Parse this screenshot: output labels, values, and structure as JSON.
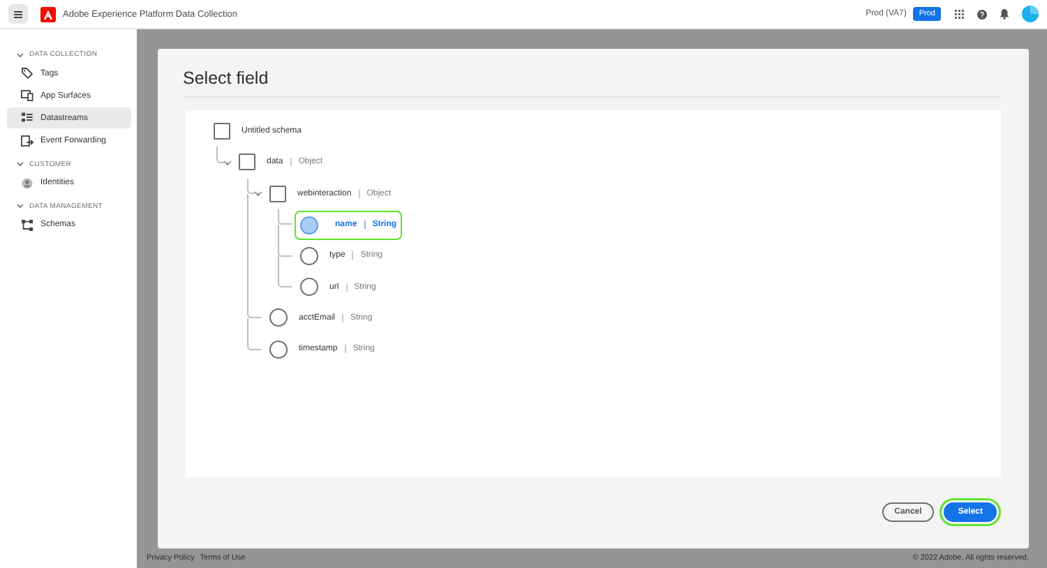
{
  "header": {
    "title": "Adobe Experience Platform Data Collection",
    "org": "Prod (VA7)",
    "sandbox_badge": "Prod"
  },
  "sidebar": {
    "sections": [
      {
        "heading": "DATA COLLECTION",
        "expanded": true,
        "items": [
          {
            "label": "Tags",
            "selected": false
          },
          {
            "label": "App Surfaces",
            "selected": false
          },
          {
            "label": "Datastreams",
            "selected": true
          },
          {
            "label": "Event Forwarding",
            "selected": false
          }
        ]
      },
      {
        "heading": "CUSTOMER",
        "expanded": true,
        "items": [
          {
            "label": "Identities",
            "selected": false
          }
        ]
      },
      {
        "heading": "DATA MANAGEMENT",
        "expanded": true,
        "items": [
          {
            "label": "Schemas",
            "selected": false
          }
        ]
      }
    ]
  },
  "modal": {
    "title": "Select field",
    "tree": [
      {
        "name": "Untitled schema",
        "kind": "object",
        "checked": false,
        "expanded": true,
        "children": [
          {
            "name": "data",
            "type": "Object",
            "kind": "object",
            "checked": false,
            "expanded": true,
            "children": [
              {
                "name": "webinteraction",
                "type": "Object",
                "kind": "object",
                "checked": false,
                "expanded": true,
                "children": [
                  {
                    "name": "name",
                    "type": "String",
                    "kind": "field",
                    "selected": true
                  },
                  {
                    "name": "type",
                    "type": "String",
                    "kind": "field",
                    "selected": false
                  },
                  {
                    "name": "url",
                    "type": "String",
                    "kind": "field",
                    "selected": false
                  }
                ]
              },
              {
                "name": "acctEmail",
                "type": "String",
                "kind": "field",
                "selected": false
              },
              {
                "name": "timestamp",
                "type": "String",
                "kind": "field",
                "selected": false
              }
            ]
          }
        ]
      }
    ],
    "buttons": [
      {
        "label": "Cancel",
        "kind": "secondary"
      },
      {
        "label": "Select",
        "kind": "primary"
      }
    ]
  },
  "footer": {
    "links": [
      "Privacy Policy",
      "Terms of Use"
    ],
    "copyright": "© 2022 Adobe. All rights reserved."
  }
}
